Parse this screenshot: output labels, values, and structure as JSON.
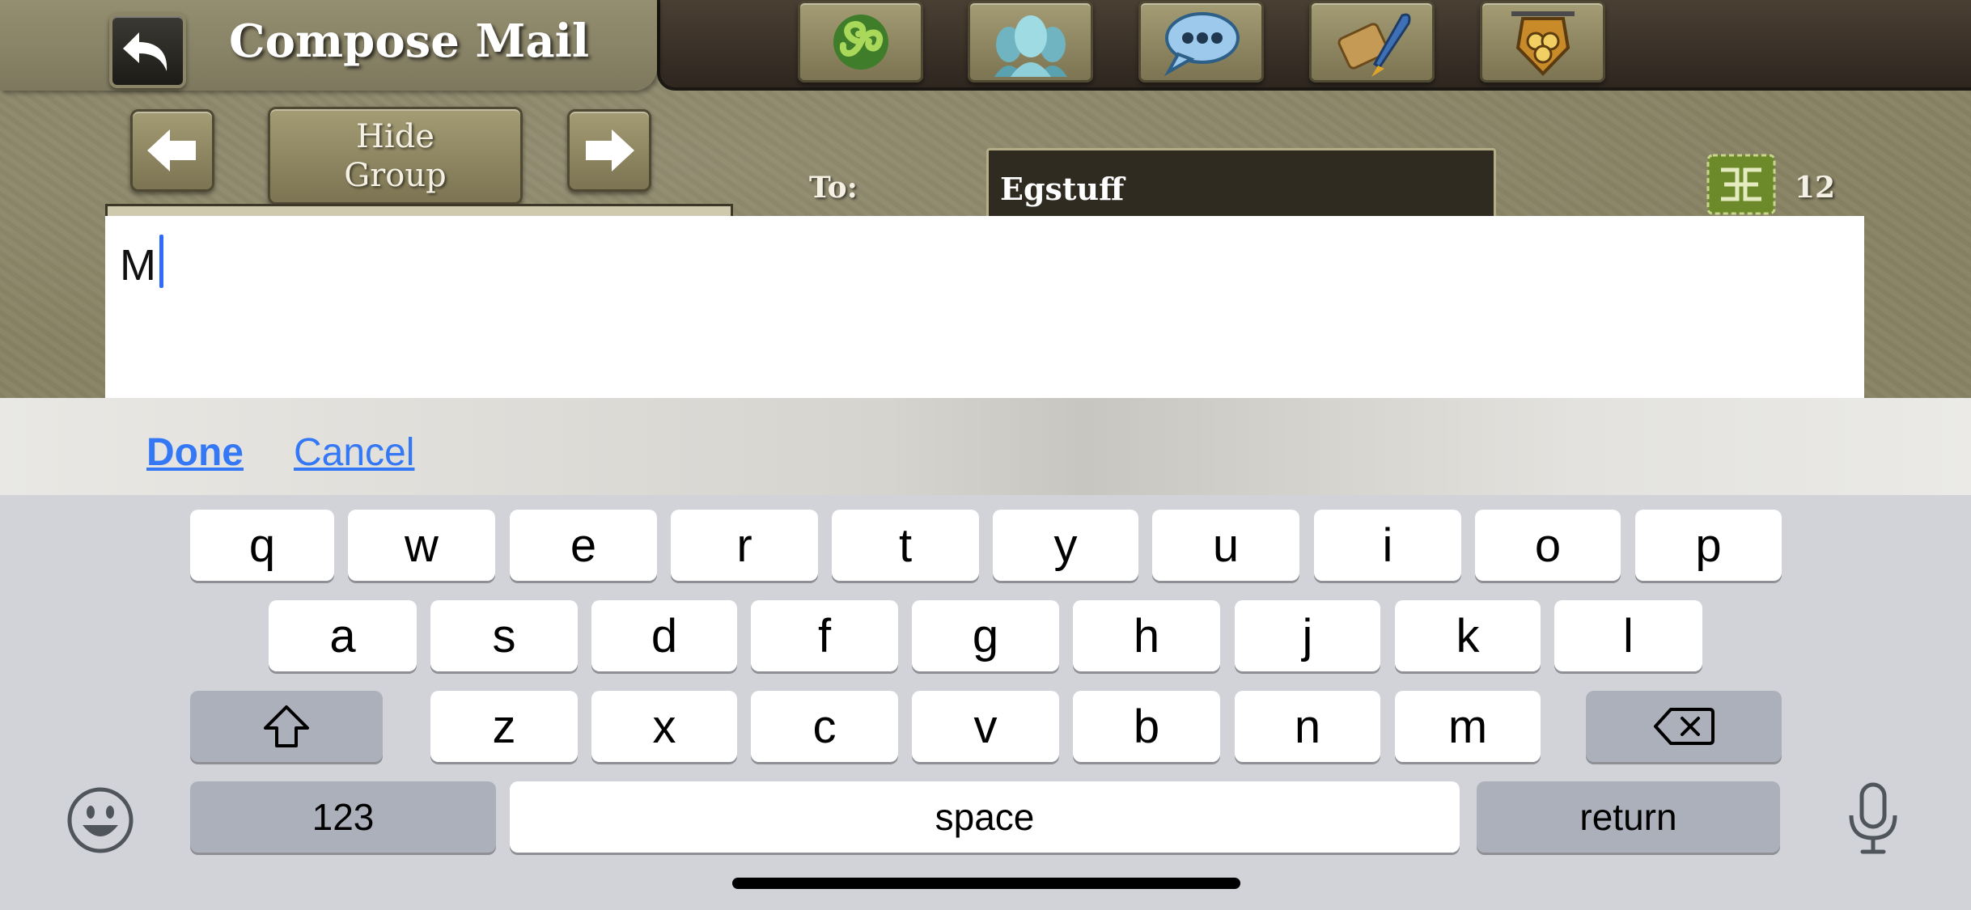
{
  "header": {
    "title": "Compose Mail",
    "back_icon": "undo-arrow-icon",
    "nav_icons": [
      "triskele-icon",
      "group-heads-icon",
      "chat-bubble-icon",
      "scroll-quill-icon",
      "guild-shield-icon"
    ]
  },
  "controls": {
    "hide_group_line1": "Hide",
    "hide_group_line2": "Group",
    "prev_icon": "arrow-left-icon",
    "next_icon": "arrow-right-icon"
  },
  "recipient": {
    "to_label": "To:",
    "to_value": "Egstuff",
    "count": "12"
  },
  "message": {
    "text": "M"
  },
  "accessory": {
    "done_label": "Done",
    "cancel_label": "Cancel"
  },
  "keyboard": {
    "row1": [
      "q",
      "w",
      "e",
      "r",
      "t",
      "y",
      "u",
      "i",
      "o",
      "p"
    ],
    "row2": [
      "a",
      "s",
      "d",
      "f",
      "g",
      "h",
      "j",
      "k",
      "l"
    ],
    "row3": [
      "z",
      "x",
      "c",
      "v",
      "b",
      "n",
      "m"
    ],
    "numbers_label": "123",
    "space_label": "space",
    "return_label": "return"
  },
  "colors": {
    "link": "#3478f6",
    "caret": "#2f6bff"
  }
}
